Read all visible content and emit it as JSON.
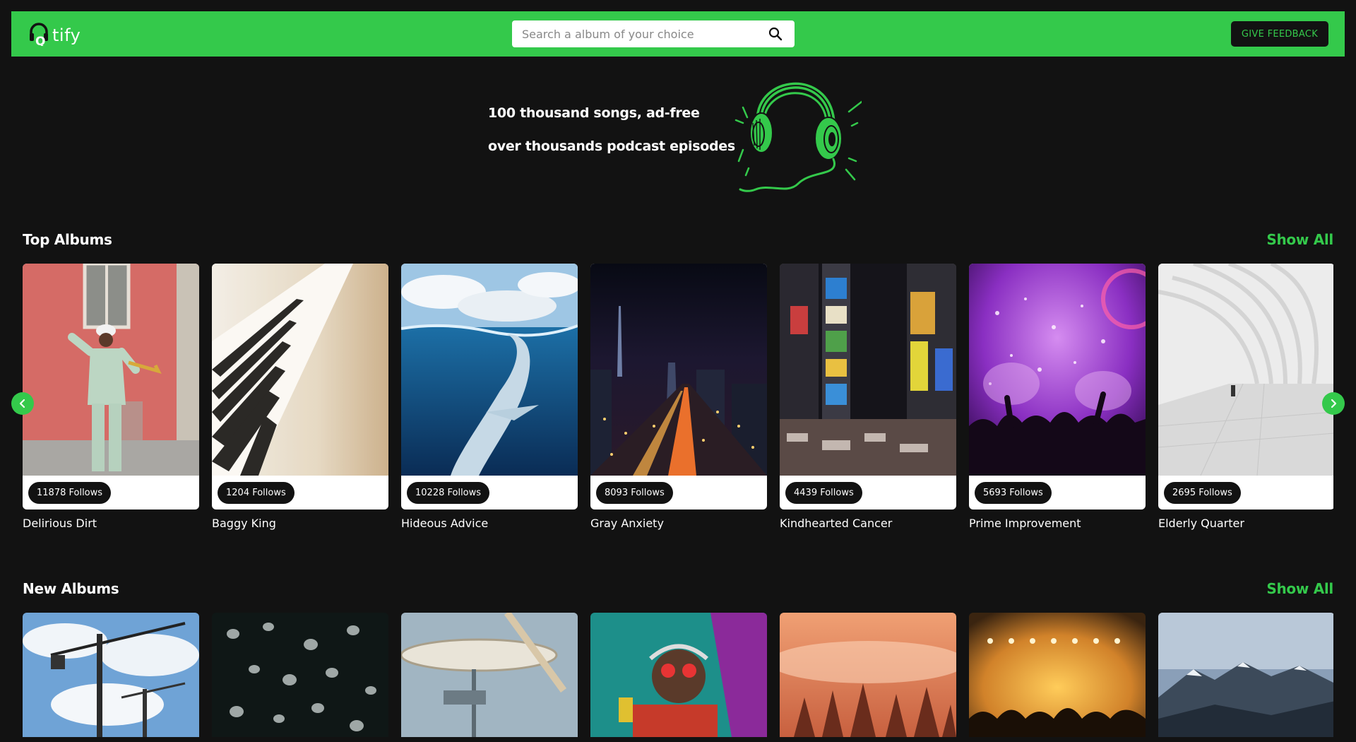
{
  "app": {
    "logo_text": "tify",
    "logo_icon": "headphones-icon",
    "accent": "#34c94b",
    "background": "#121212"
  },
  "search": {
    "placeholder": "Search a album of your choice",
    "value": "",
    "icon": "search-icon"
  },
  "feedback_label": "GIVE FEEDBACK",
  "hero": {
    "line1": "100 thousand songs, ad-free",
    "line2": "over thousands podcast episodes"
  },
  "top_albums": {
    "title": "Top Albums",
    "show_all": "Show All",
    "items": [
      {
        "name": "Delirious Dirt",
        "follows": "11878 Follows"
      },
      {
        "name": "Baggy King",
        "follows": "1204 Follows"
      },
      {
        "name": "Hideous Advice",
        "follows": "10228 Follows"
      },
      {
        "name": "Gray Anxiety",
        "follows": "8093 Follows"
      },
      {
        "name": "Kindhearted Cancer",
        "follows": "4439 Follows"
      },
      {
        "name": "Prime Improvement",
        "follows": "5693 Follows"
      },
      {
        "name": "Elderly Quarter",
        "follows": "2695 Follows"
      }
    ]
  },
  "new_albums": {
    "title": "New Albums",
    "show_all": "Show All"
  }
}
